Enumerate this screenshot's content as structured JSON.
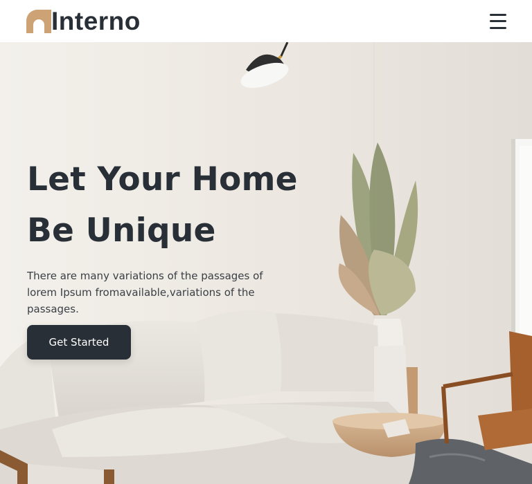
{
  "brand": {
    "name": "Interno",
    "accent_color": "#cda274",
    "text_color": "#292f36"
  },
  "nav": {
    "menu_icon": "hamburger-menu-icon"
  },
  "hero": {
    "title_line1": "Let Your Home",
    "title_line2": "Be Unique",
    "description": "There are many variations of the passages of lorem Ipsum fromavailable,variations of the passages.",
    "cta_label": "Get Started",
    "background": "living-room-photo"
  }
}
